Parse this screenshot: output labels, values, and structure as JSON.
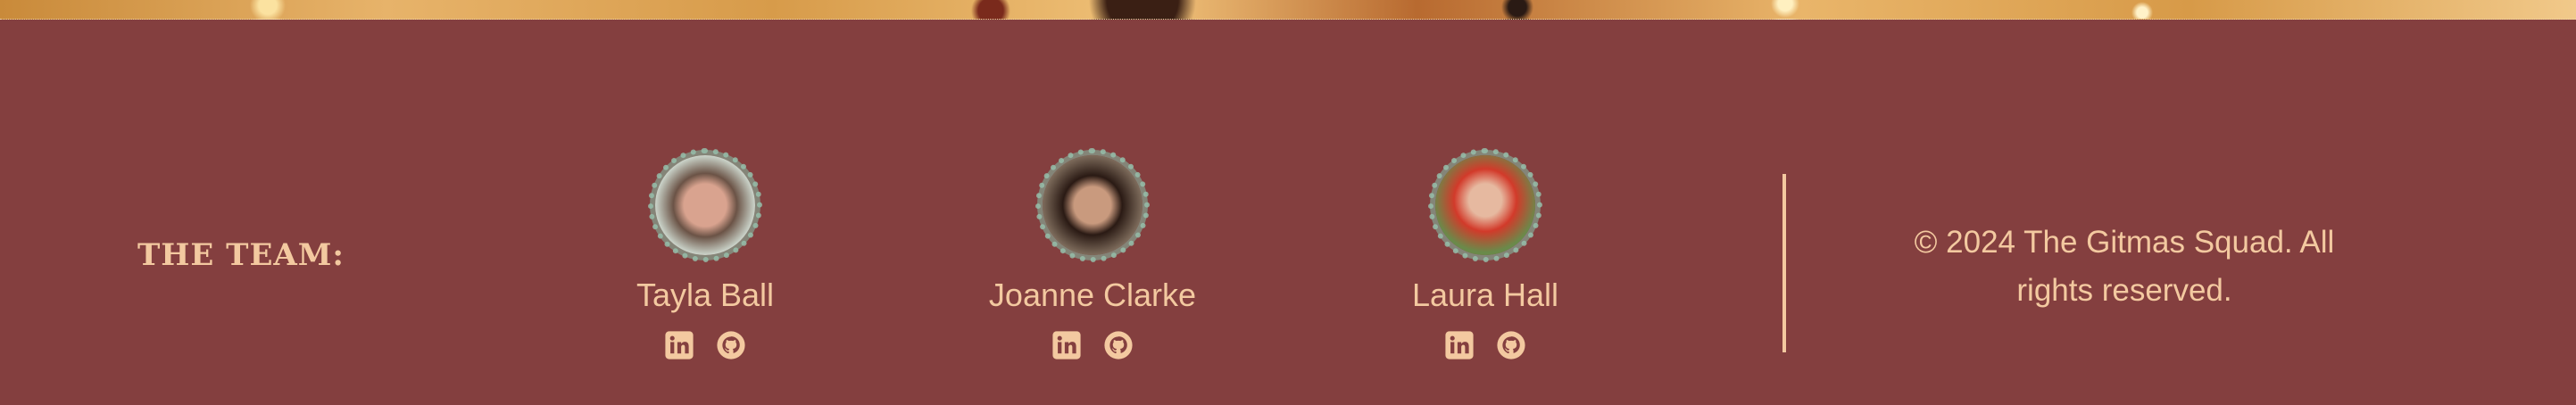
{
  "footer": {
    "team_heading": "THE TEAM:",
    "members": [
      {
        "name": "Tayla Ball",
        "icons": [
          "linkedin-icon",
          "github-icon"
        ]
      },
      {
        "name": "Joanne Clarke",
        "icons": [
          "linkedin-icon",
          "github-icon"
        ]
      },
      {
        "name": "Laura Hall",
        "icons": [
          "linkedin-icon",
          "github-icon"
        ]
      }
    ],
    "copyright": "© 2024 The Gitmas Squad. All rights reserved."
  },
  "colors": {
    "background": "#843f3f",
    "text": "#f3c9a0"
  }
}
